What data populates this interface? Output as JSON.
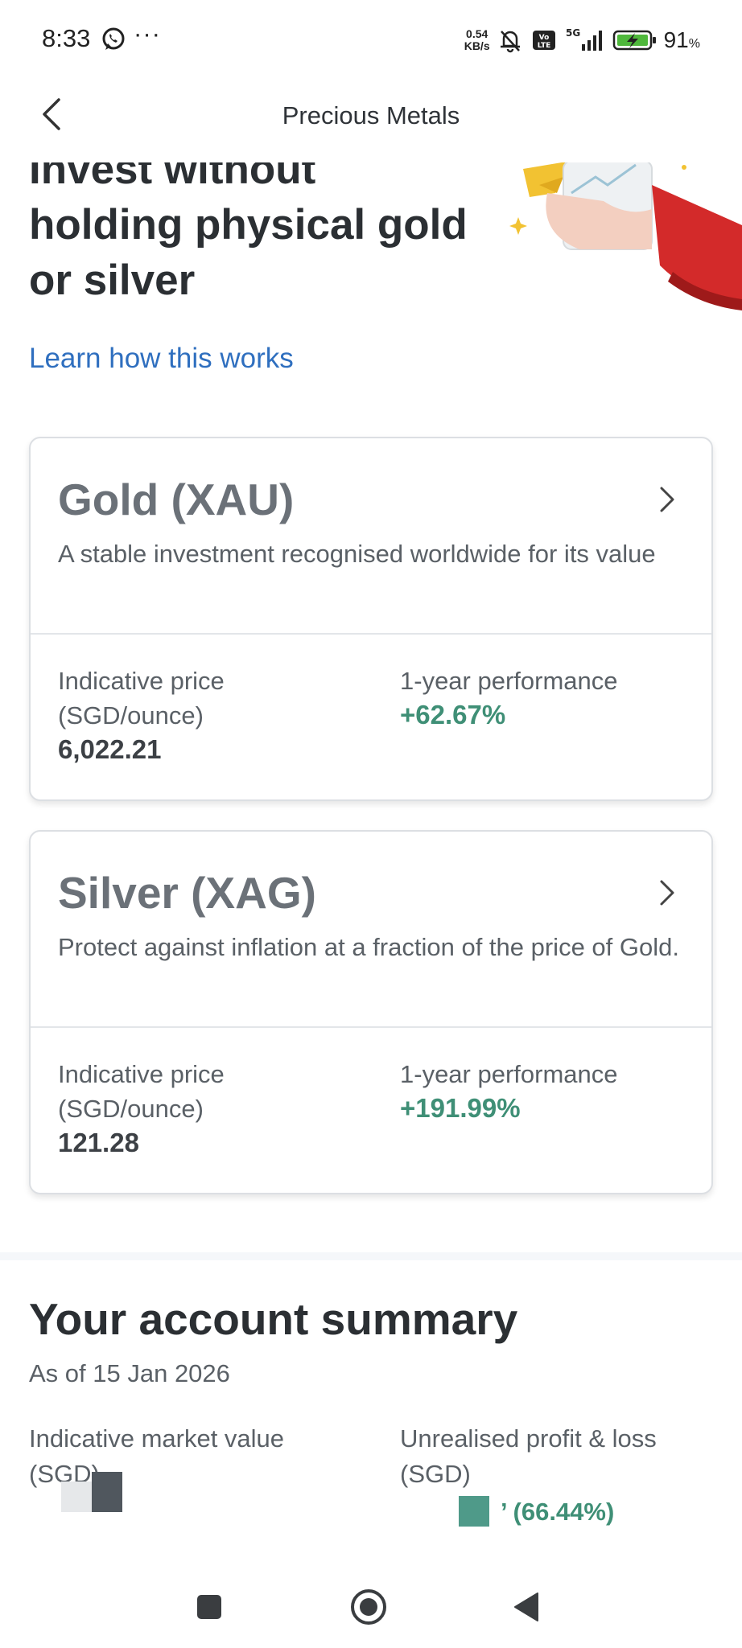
{
  "status_bar": {
    "time": "8:33",
    "more": "···",
    "speed_value": "0.54",
    "speed_unit": "KB/s",
    "network": "5G",
    "volte": "Vo LTE",
    "battery": "91",
    "battery_unit": "%"
  },
  "header": {
    "title": "Precious Metals"
  },
  "hero": {
    "title": "Invest without holding physical gold or silver",
    "learn_link": "Learn how this works"
  },
  "products": [
    {
      "title": "Gold (XAU)",
      "description": "A stable investment recognised worldwide for its value",
      "price_label": "Indicative price (SGD/ounce)",
      "price": "6,022.21",
      "performance_label": "1-year performance",
      "performance": "+62.67%"
    },
    {
      "title": "Silver (XAG)",
      "description": "Protect against inflation at a fraction of the price of Gold.",
      "price_label": "Indicative price (SGD/ounce)",
      "price": "121.28",
      "performance_label": "1-year performance",
      "performance": "+191.99%"
    }
  ],
  "account": {
    "title": "Your account summary",
    "as_of": "As of 15 Jan 2026",
    "market_value_label": "Indicative market value (SGD)",
    "pl_label": "Unrealised profit & loss (SGD)",
    "pl_percent": "’ (66.44%)"
  },
  "colors": {
    "link": "#2f6fbf",
    "positive": "#3f8f76",
    "card_border": "#dcdfe3"
  }
}
